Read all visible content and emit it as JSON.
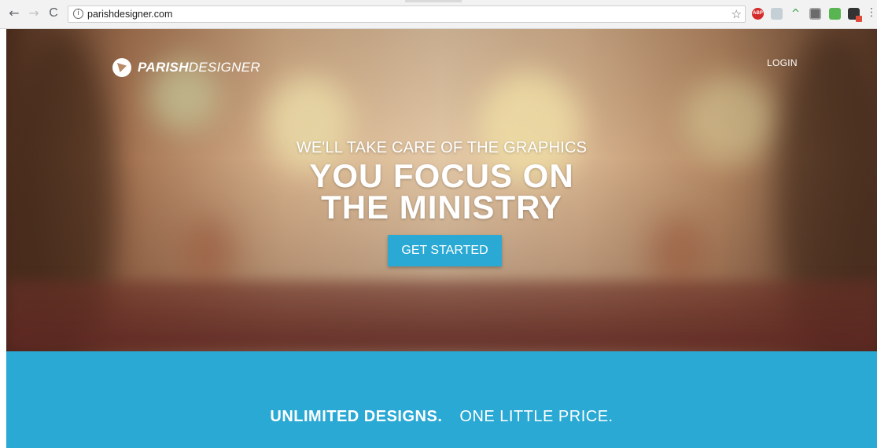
{
  "browser": {
    "back_glyph": "←",
    "forward_glyph": "→",
    "reload_glyph": "C",
    "info_glyph": "i",
    "url": "parishdesigner.com",
    "bookmark_glyph": "☆",
    "menu_glyph": "⋮",
    "extensions": [
      "adblock-plus-icon",
      "extension-icon",
      "extension-icon",
      "extension-icon",
      "extension-icon",
      "extension-icon"
    ],
    "abp_label": "ABP"
  },
  "header": {
    "logo_bold": "PARISH",
    "logo_light": "DESIGNER",
    "login_label": "LOGIN"
  },
  "hero": {
    "tagline_small": "WE'LL TAKE CARE OF THE GRAPHICS",
    "tagline_line1": "YOU FOCUS ON",
    "tagline_line2": "THE MINISTRY",
    "cta_label": "GET STARTED"
  },
  "band": {
    "strong": "UNLIMITED DESIGNS.",
    "light": "ONE LITTLE PRICE."
  },
  "colors": {
    "accent": "#2aa9d4"
  }
}
